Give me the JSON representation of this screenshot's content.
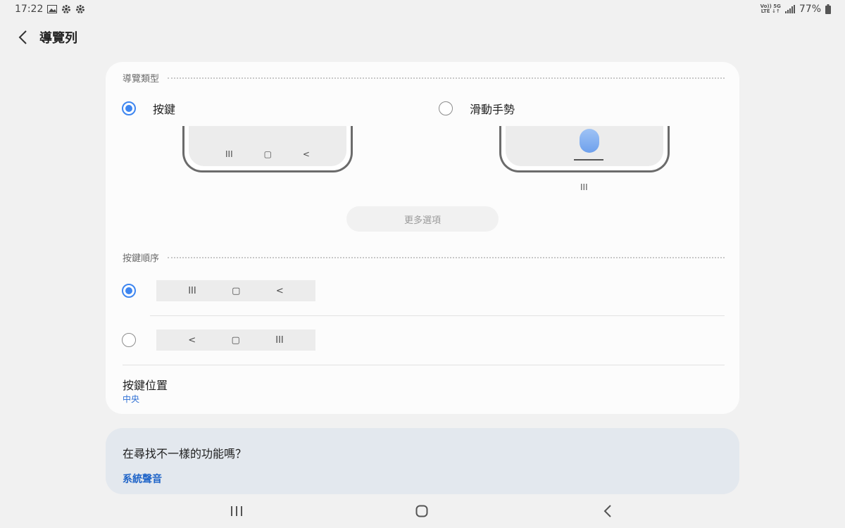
{
  "status_bar": {
    "time": "17:22",
    "net_top": "Vo)) 5G",
    "net_bottom": "LTE ↓↑",
    "battery": "77%",
    "icons": [
      "gallery-icon",
      "gear-icon",
      "gear-icon",
      "volte-icon",
      "signal-icon",
      "battery-icon"
    ]
  },
  "header": {
    "title": "導覽列",
    "back_icon": "chevron-left-icon"
  },
  "nav_type": {
    "section_label": "導覽類型",
    "options": [
      {
        "label": "按鍵",
        "selected": true
      },
      {
        "label": "滑動手勢",
        "selected": false
      }
    ],
    "buttons_preview": [
      "III",
      "▢",
      "<"
    ],
    "gesture_hint": "III",
    "more_options": "更多選項"
  },
  "button_order": {
    "section_label": "按鍵順序",
    "options": [
      {
        "buttons": [
          "III",
          "▢",
          "<"
        ],
        "selected": true
      },
      {
        "buttons": [
          "<",
          "▢",
          "III"
        ],
        "selected": false
      }
    ]
  },
  "button_position": {
    "title": "按鍵位置",
    "value": "中央"
  },
  "suggestion": {
    "title": "在尋找不一樣的功能嗎？",
    "link": "系統聲音"
  },
  "colors": {
    "accent": "#3e86f0",
    "link": "#1f64c8",
    "background": "#f1f1f1",
    "card": "#fcfcfc",
    "suggest_card": "#e3e8ee"
  }
}
